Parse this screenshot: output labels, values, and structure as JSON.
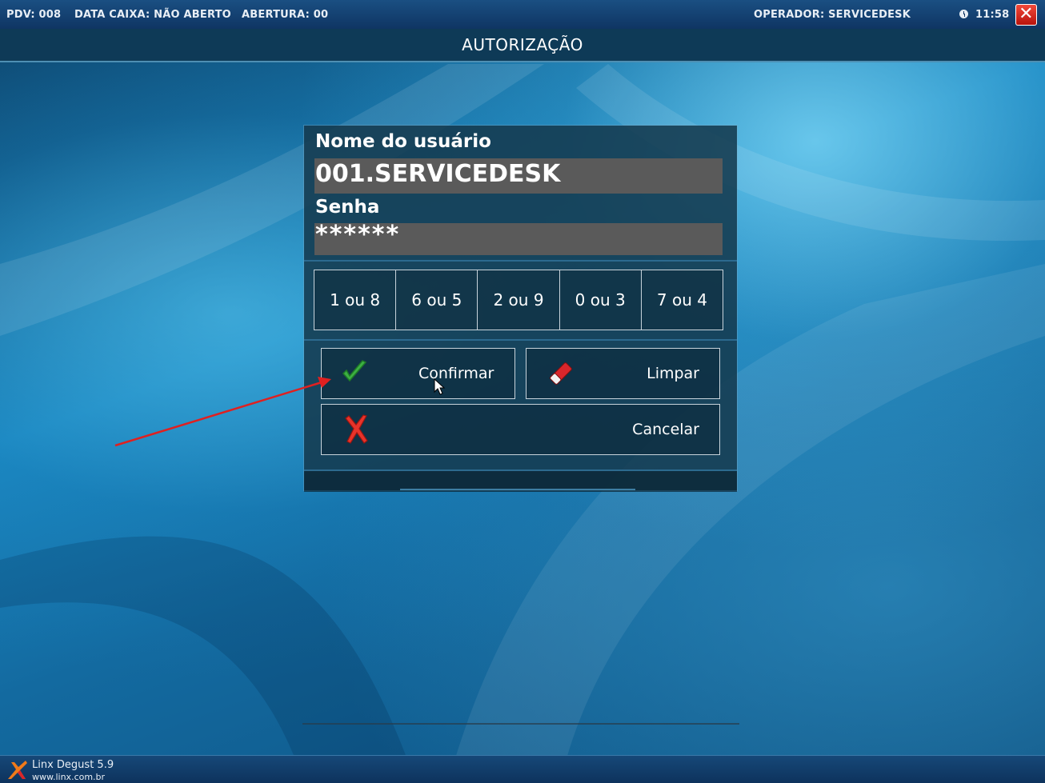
{
  "topbar": {
    "pdv": "PDV: 008",
    "data_caixa": "DATA CAIXA: NÃO ABERTO",
    "abertura": "ABERTURA: 00",
    "operador": "OPERADOR: SERVICEDESK",
    "time": "11:58",
    "close_icon": "close-icon"
  },
  "title": "AUTORIZAÇÃO",
  "dialog": {
    "user_label": "Nome do usuário",
    "user_value": "001.SERVICEDESK",
    "password_label": "Senha",
    "password_value": "******",
    "digit_keys": [
      "1 ou 8",
      "6 ou 5",
      "2 ou 9",
      "0 ou 3",
      "7 ou 4"
    ],
    "confirm_label": "Confirmar",
    "clear_label": "Limpar",
    "cancel_label": "Cancelar"
  },
  "taskbar": {
    "app_name": "Linx Degust 5.9",
    "app_url": "www.linx.com.br"
  },
  "colors": {
    "topbar": "#164878",
    "dialog_bg": "#143a4e",
    "field_bg": "#5a5a5a",
    "confirm_icon": "#3cb043",
    "cancel_icon": "#e8332a",
    "annotation_arrow": "#e02020"
  }
}
